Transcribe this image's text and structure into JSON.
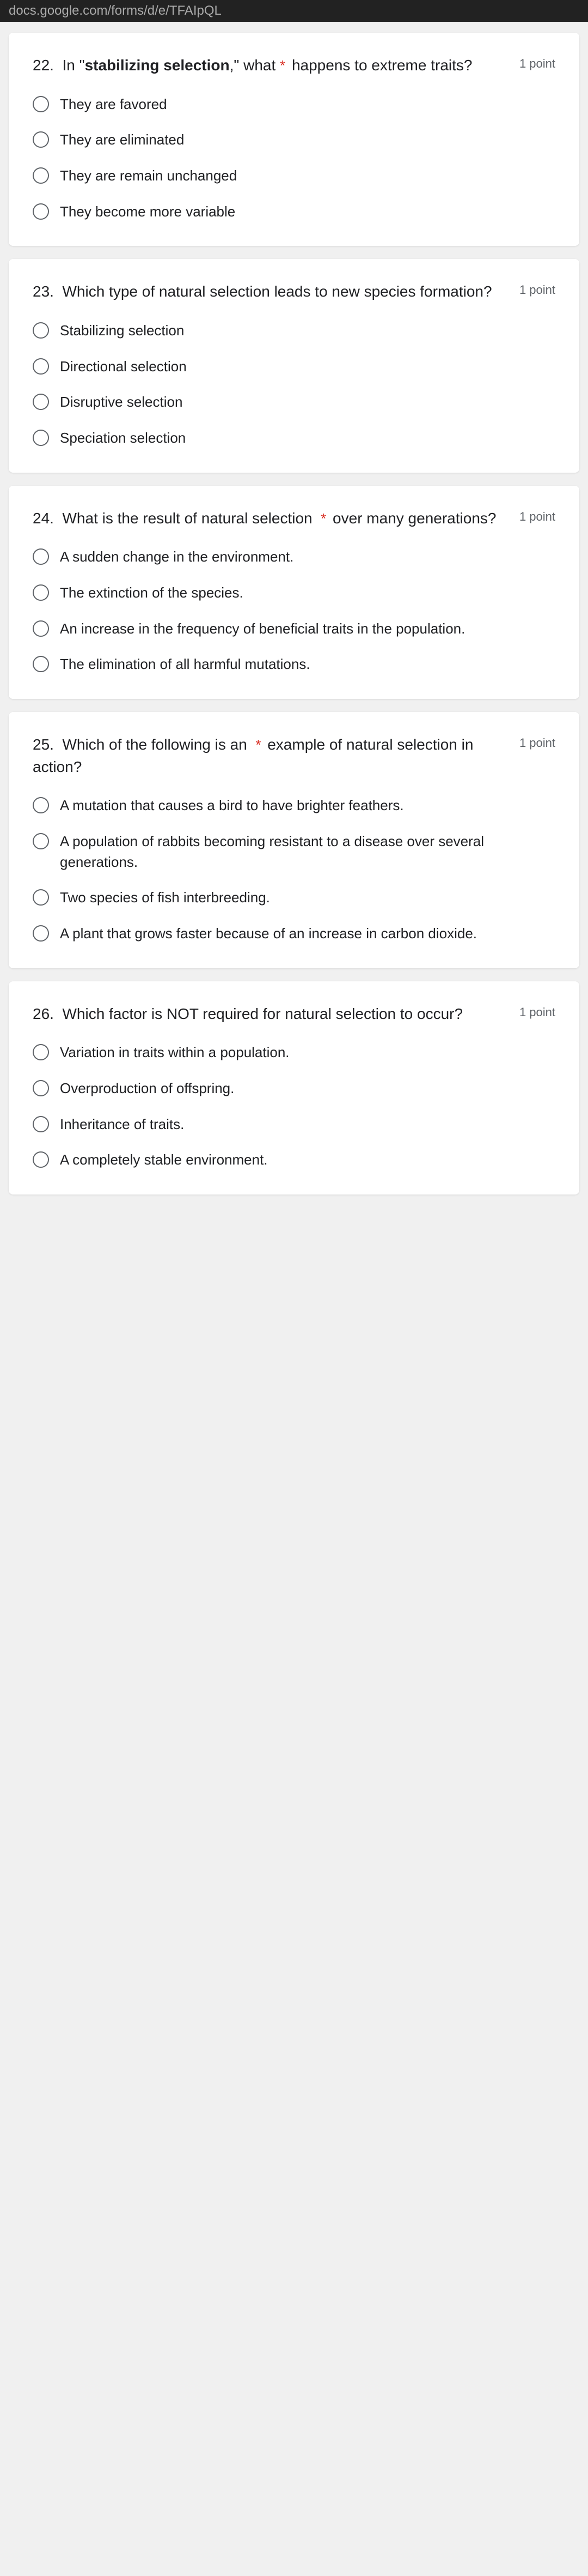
{
  "topBar": {
    "url": "docs.google.com/forms/d/e/TFAIpQL"
  },
  "questions": [
    {
      "id": "q22",
      "number": "22.",
      "text_before": "In \"",
      "bold_text": "stabilizing selection",
      "text_after": ",\" what happens to extreme traits?",
      "required": true,
      "points": "1 point",
      "options": [
        {
          "id": "q22a",
          "text": "They are favored"
        },
        {
          "id": "q22b",
          "text": "They are eliminated"
        },
        {
          "id": "q22c",
          "text": "They are remain unchanged"
        },
        {
          "id": "q22d",
          "text": "They become more variable"
        }
      ]
    },
    {
      "id": "q23",
      "number": "23.",
      "text_before": "Which type of natural selection leads to new species formation?",
      "bold_text": "",
      "text_after": "",
      "required": false,
      "points": "1 point",
      "options": [
        {
          "id": "q23a",
          "text": "Stabilizing selection"
        },
        {
          "id": "q23b",
          "text": "Directional selection"
        },
        {
          "id": "q23c",
          "text": "Disruptive selection"
        },
        {
          "id": "q23d",
          "text": "Speciation selection"
        }
      ]
    },
    {
      "id": "q24",
      "number": "24.",
      "text_before": "What is the result of natural selection over many generations?",
      "bold_text": "",
      "text_after": "",
      "required": true,
      "points": "1 point",
      "options": [
        {
          "id": "q24a",
          "text": "A sudden change in the environment."
        },
        {
          "id": "q24b",
          "text": "The extinction of the species."
        },
        {
          "id": "q24c",
          "text": "An increase in the frequency of beneficial traits in the population."
        },
        {
          "id": "q24d",
          "text": "The elimination of all harmful mutations."
        }
      ]
    },
    {
      "id": "q25",
      "number": "25.",
      "text_before": "Which of the following is an example of natural selection in action?",
      "bold_text": "",
      "text_after": "",
      "required": true,
      "points": "1 point",
      "options": [
        {
          "id": "q25a",
          "text": "A mutation that causes a bird to have brighter feathers."
        },
        {
          "id": "q25b",
          "text": "A population of rabbits becoming resistant to a disease over several generations."
        },
        {
          "id": "q25c",
          "text": "Two species of fish interbreeding."
        },
        {
          "id": "q25d",
          "text": "A plant that grows faster because of an increase in carbon dioxide."
        }
      ]
    },
    {
      "id": "q26",
      "number": "26.",
      "text_before": "Which factor is NOT required for natural selection to occur?",
      "bold_text": "",
      "text_after": "",
      "required": false,
      "points": "1 point",
      "options": [
        {
          "id": "q26a",
          "text": "Variation in traits within a population."
        },
        {
          "id": "q26b",
          "text": "Overproduction of offspring."
        },
        {
          "id": "q26c",
          "text": "Inheritance of traits."
        },
        {
          "id": "q26d",
          "text": "A completely stable environment."
        }
      ]
    }
  ]
}
